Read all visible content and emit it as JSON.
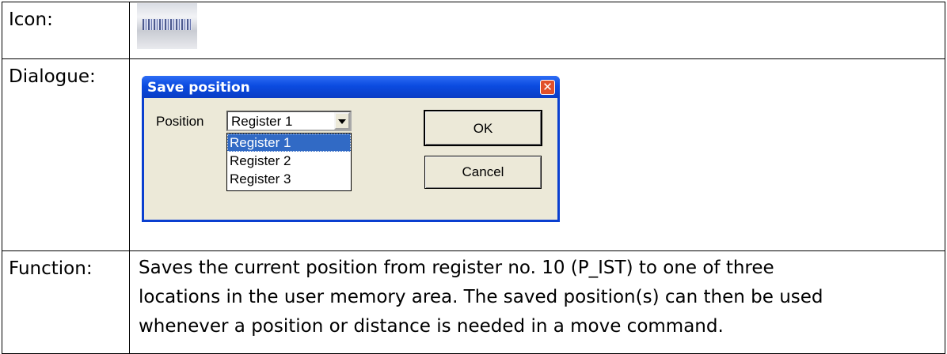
{
  "rows": {
    "icon": {
      "label": "Icon:"
    },
    "dialogue": {
      "label": "Dialogue:"
    },
    "function": {
      "label": "Function:",
      "lines": [
        "Saves the current position from register no. 10 (P_IST) to one of three",
        "locations in the user memory area. The saved position(s) can then be used",
        "whenever a position or distance is needed in a move command."
      ]
    }
  },
  "dialog": {
    "title": "Save position",
    "close_glyph": "✕",
    "position_label": "Position",
    "selected": "Register 1",
    "options": [
      "Register 1",
      "Register 2",
      "Register 3"
    ],
    "ok_label": "OK",
    "cancel_label": "Cancel"
  },
  "icons": {
    "tool_icon": "save-position-icon",
    "close": "close-icon",
    "dropdown": "chevron-down-icon"
  },
  "colors": {
    "titlebar": "#0b4be0",
    "dialog_face": "#ece9d8",
    "selection": "#316ac5",
    "close_button": "#e1502a"
  }
}
